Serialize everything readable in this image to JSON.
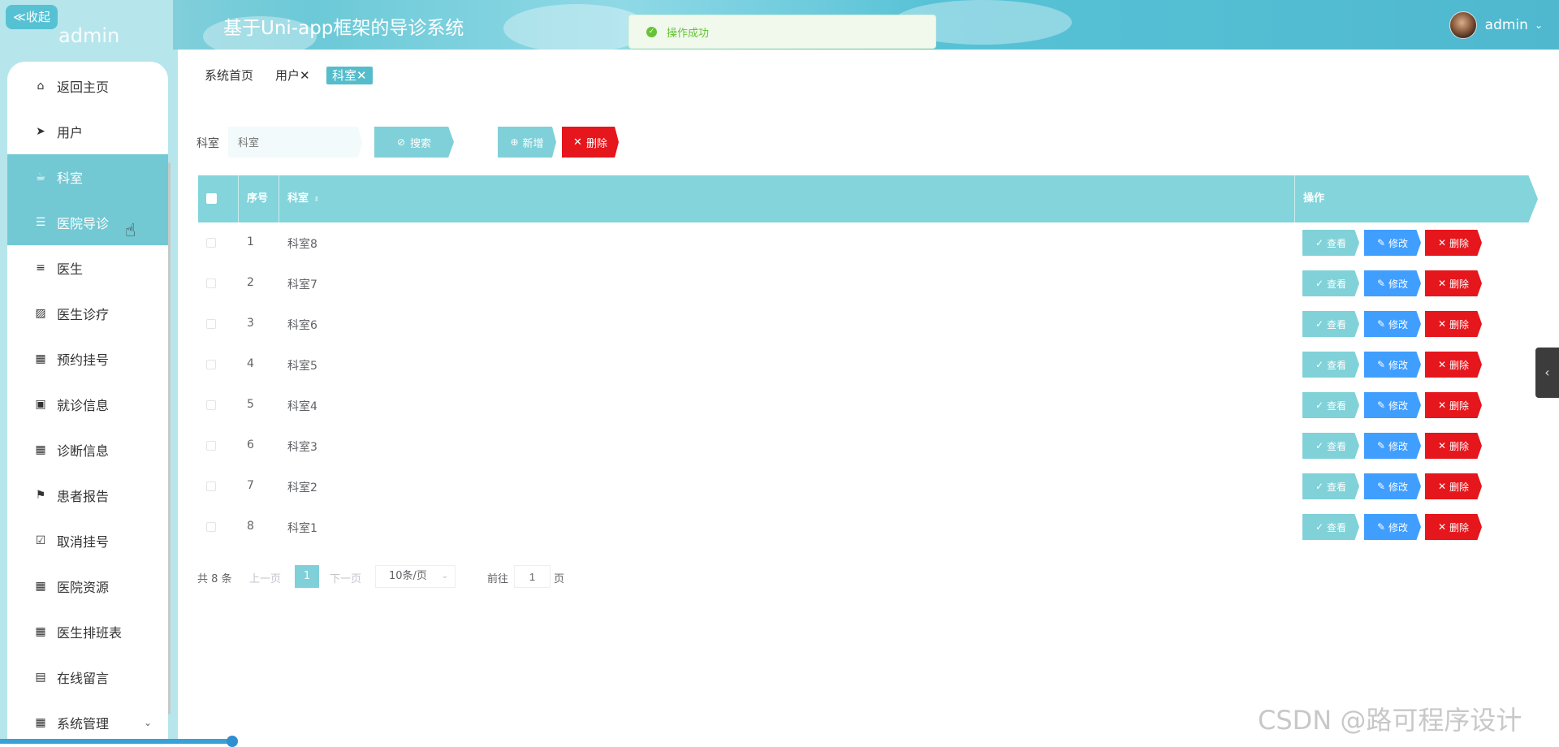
{
  "header": {
    "title": "基于Uni-app框架的导诊系统",
    "collapse_label": "≪收起",
    "toast": "操作成功",
    "username": "admin"
  },
  "sidebar": {
    "ghost_text": "admin",
    "items": [
      {
        "label": "返回主页",
        "icon": "home-icon",
        "glyph": "⌂"
      },
      {
        "label": "用户",
        "icon": "send-icon",
        "glyph": "➤"
      },
      {
        "label": "科室",
        "icon": "cup-icon",
        "glyph": "☕",
        "active": true
      },
      {
        "label": "医院导诊",
        "icon": "grid-list-icon",
        "glyph": "☰",
        "active": true
      },
      {
        "label": "医生",
        "icon": "list-icon",
        "glyph": "≡"
      },
      {
        "label": "医生诊疗",
        "icon": "chart-icon",
        "glyph": "▨"
      },
      {
        "label": "预约挂号",
        "icon": "apps-icon",
        "glyph": "▦"
      },
      {
        "label": "就诊信息",
        "icon": "wallet-icon",
        "glyph": "▣"
      },
      {
        "label": "诊断信息",
        "icon": "apps-icon",
        "glyph": "▦"
      },
      {
        "label": "患者报告",
        "icon": "flag-icon",
        "glyph": "⚑"
      },
      {
        "label": "取消挂号",
        "icon": "clipboard-check-icon",
        "glyph": "☑"
      },
      {
        "label": "医院资源",
        "icon": "apps-icon",
        "glyph": "▦"
      },
      {
        "label": "医生排班表",
        "icon": "apps-icon",
        "glyph": "▦"
      },
      {
        "label": "在线留言",
        "icon": "message-icon",
        "glyph": "▤"
      },
      {
        "label": "系统管理",
        "icon": "apps-icon",
        "glyph": "▦",
        "has_submenu": true
      }
    ]
  },
  "tabs": [
    {
      "label": "系统首页"
    },
    {
      "label": "用户✕"
    },
    {
      "label": "科室✕",
      "active": true
    }
  ],
  "search": {
    "label": "科室",
    "placeholder": "科室",
    "search_button": "搜索",
    "add_button": "新增",
    "delete_button": "删除"
  },
  "table": {
    "columns": [
      "序号",
      "科室",
      "操作"
    ],
    "rows": [
      {
        "index": "1",
        "name": "科室8"
      },
      {
        "index": "2",
        "name": "科室7"
      },
      {
        "index": "3",
        "name": "科室6"
      },
      {
        "index": "4",
        "name": "科室5"
      },
      {
        "index": "5",
        "name": "科室4"
      },
      {
        "index": "6",
        "name": "科室3"
      },
      {
        "index": "7",
        "name": "科室2"
      },
      {
        "index": "8",
        "name": "科室1"
      }
    ],
    "actions": {
      "view": "查看",
      "edit": "修改",
      "delete": "删除"
    }
  },
  "pagination": {
    "total": "共 8 条",
    "prev": "上一页",
    "current": "1",
    "next": "下一页",
    "page_size": "10条/页",
    "goto_label": "前往",
    "goto_value": "1",
    "page_suffix": "页"
  },
  "watermark": "CSDN @路可程序设计",
  "colors": {
    "accent": "#7fd0d8",
    "danger": "#e5161c",
    "primary": "#409eff",
    "success": "#67c23a"
  }
}
